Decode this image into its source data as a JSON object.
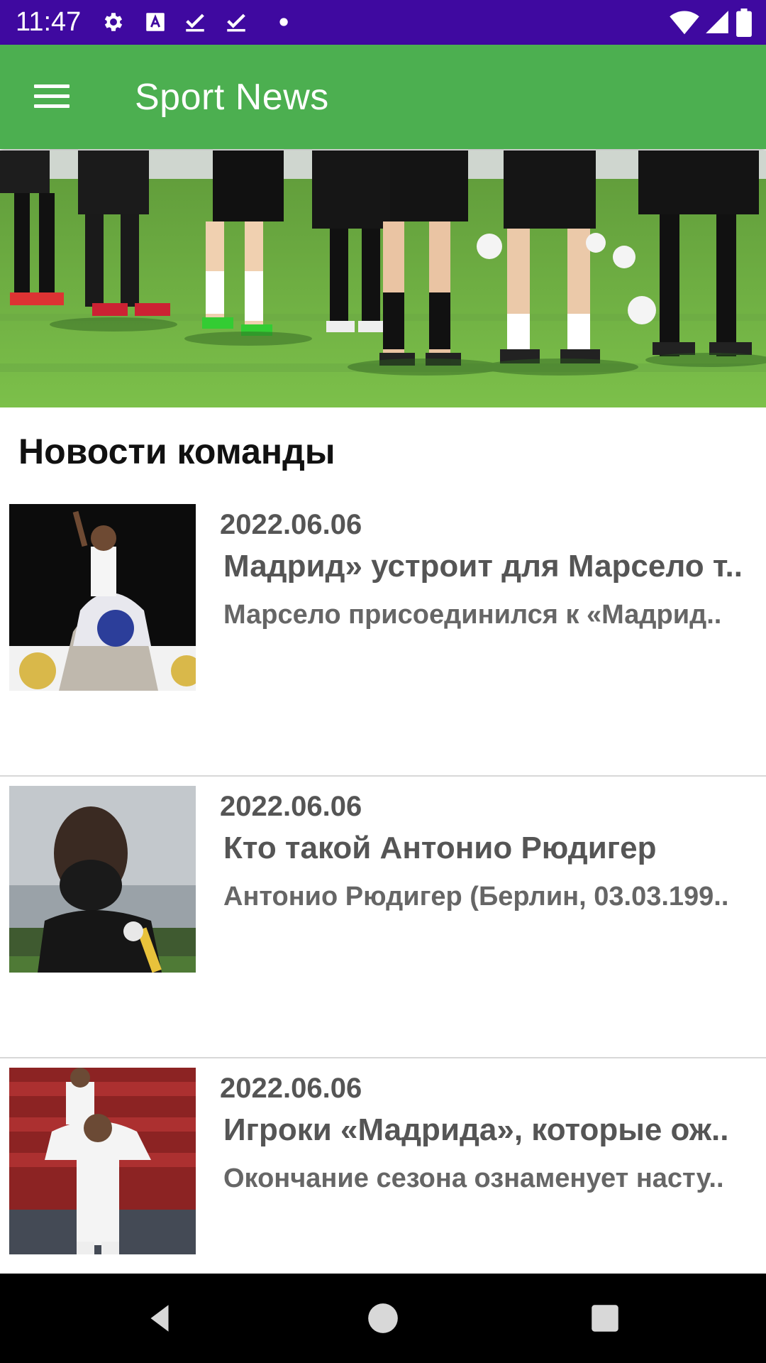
{
  "status_bar": {
    "time": "11:47",
    "icons_left": [
      "gear-icon",
      "font-icon",
      "download-done-icon",
      "download-done-icon",
      "dot-icon"
    ],
    "icons_right": [
      "wifi-icon",
      "signal-icon",
      "battery-icon"
    ],
    "color": "#3f09a0"
  },
  "app_bar": {
    "title": "Sport News",
    "menu_icon": "hamburger-menu-icon",
    "color": "#4caf50"
  },
  "hero": {
    "description_icon": "football-team-training-image"
  },
  "section": {
    "title": "Новости команды"
  },
  "news": [
    {
      "date": "2022.06.06",
      "title": "Мадрид» устроит для Марсело т..",
      "summary": "Марсело присоединился к «Мадрид.."
    },
    {
      "date": "2022.06.06",
      "title": "Кто такой Антонио Рюдигер",
      "summary": "Антонио Рюдигер (Берлин, 03.03.199.."
    },
    {
      "date": "2022.06.06",
      "title": "Игроки «Мадрида», которые ож..",
      "summary": "Окончание сезона ознаменует насту.."
    }
  ],
  "nav_bar": {
    "buttons": [
      "back-icon",
      "home-icon",
      "recents-icon"
    ]
  }
}
